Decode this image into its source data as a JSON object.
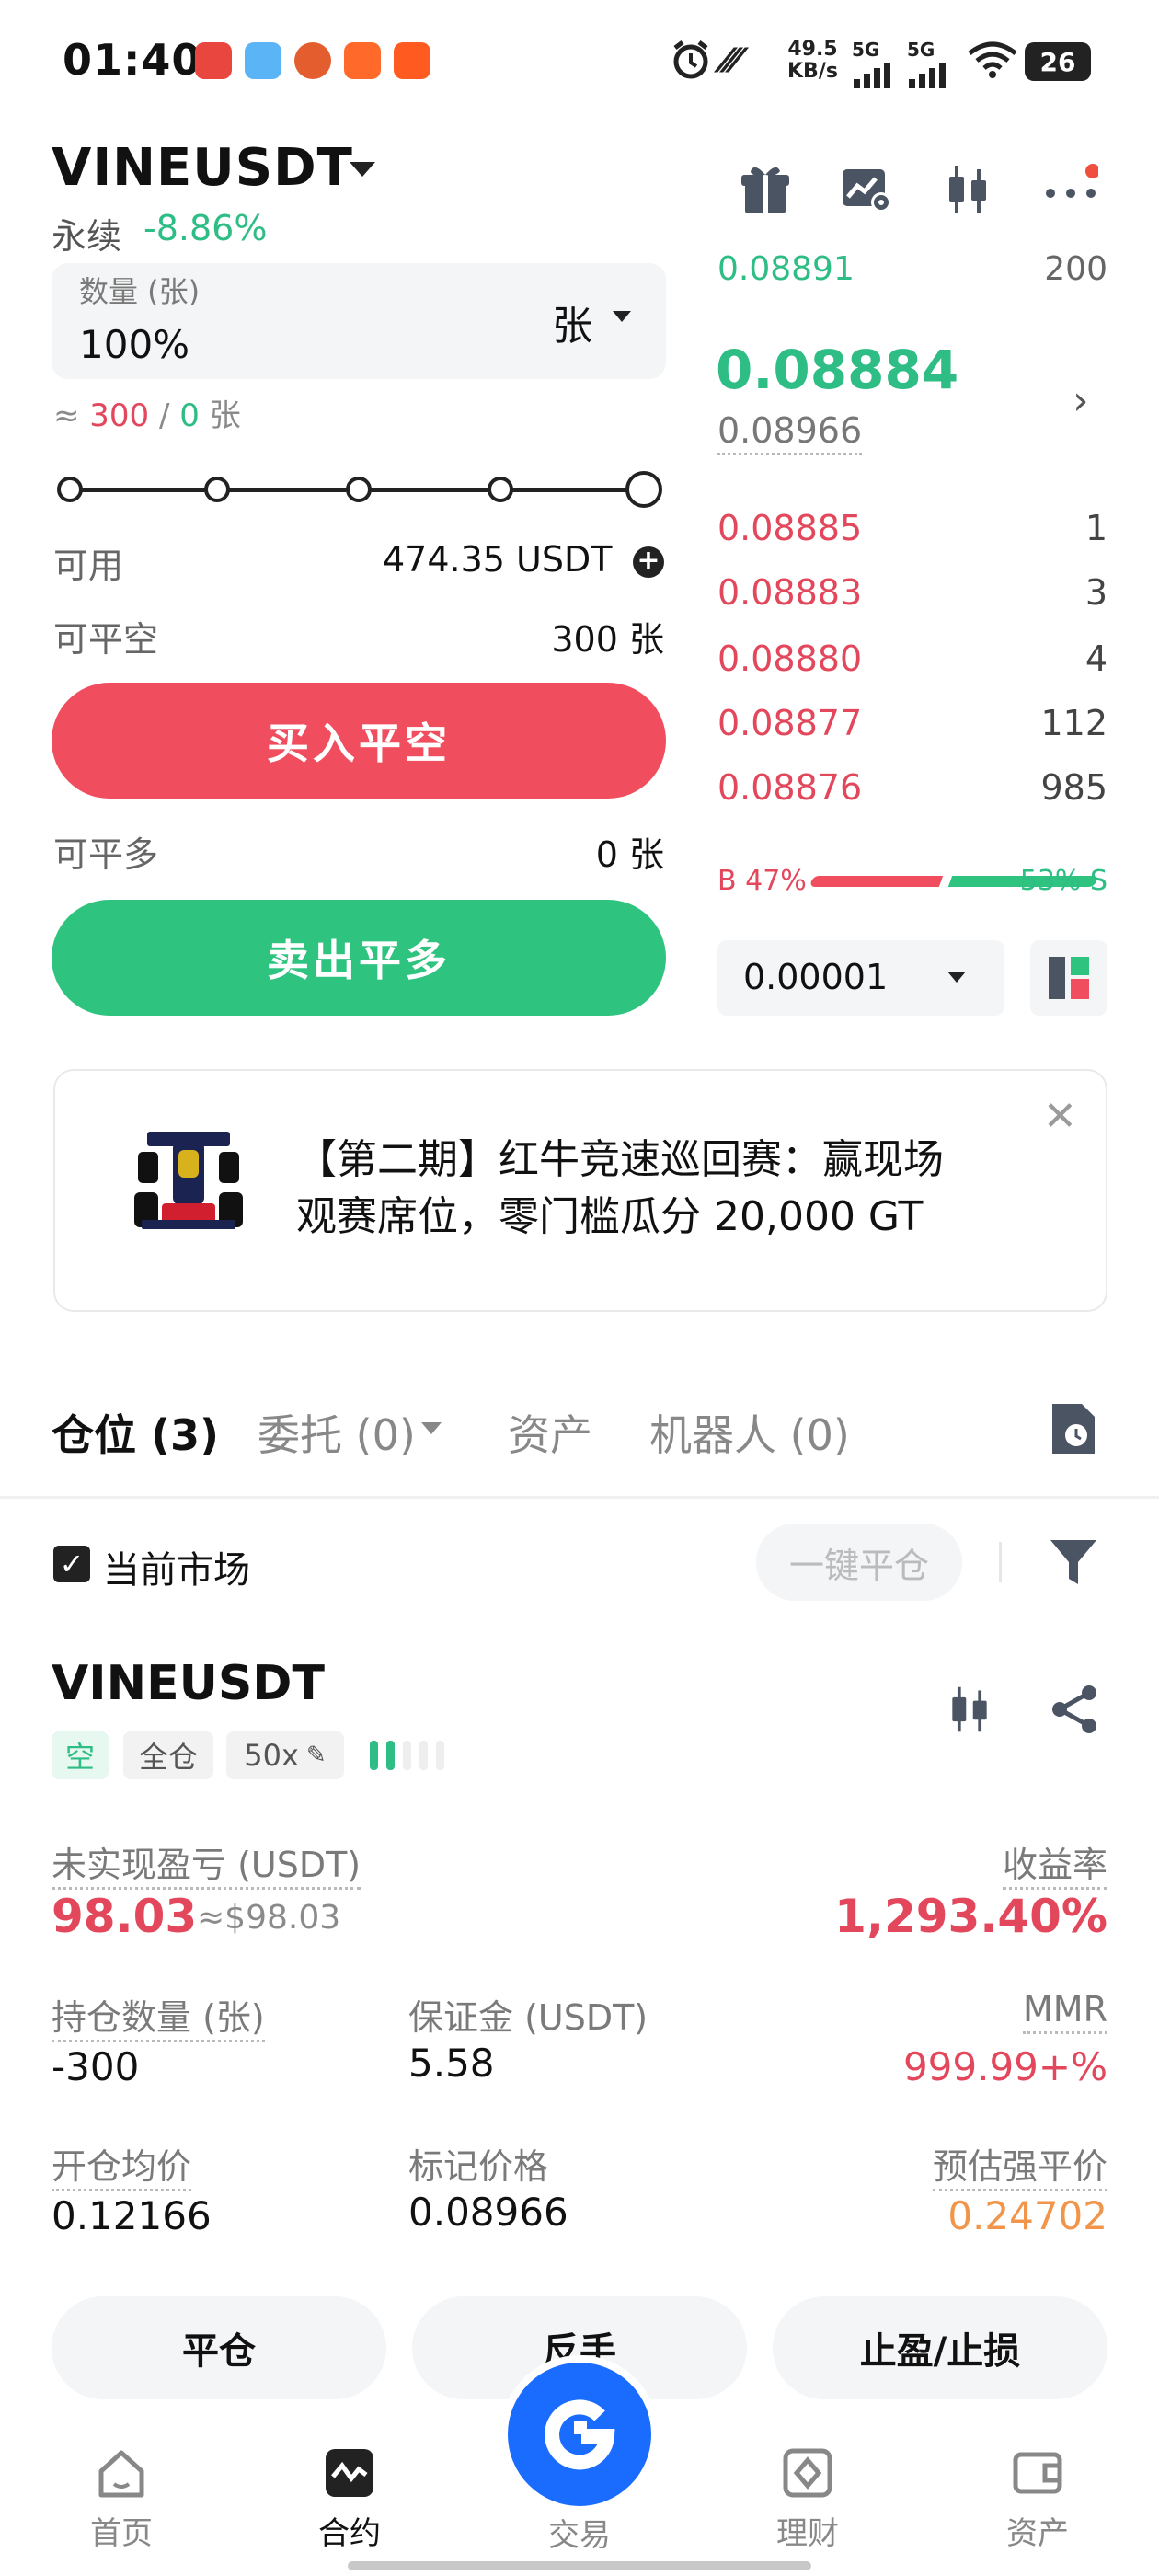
{
  "status_bar": {
    "time": "01:40",
    "net_speed": "49.5",
    "net_unit": "KB/s",
    "sig1": "5G",
    "sig2": "5G",
    "battery": "26"
  },
  "header": {
    "pair": "VINEUSDT",
    "type": "永续",
    "change": "-8.86%"
  },
  "form": {
    "qty_label": "数量 (张)",
    "qty_value": "100%",
    "unit": "张",
    "approx_prefix": "≈ ",
    "approx_red": "300",
    "approx_sep": " / ",
    "approx_green": "0",
    "approx_unit": " 张",
    "slider_fraction": 1.0,
    "available_label": "可用",
    "available_value": "474.35 USDT",
    "close_short_label": "可平空",
    "close_short_value": "300 张",
    "buy_close_short": "买入平空",
    "close_long_label": "可平多",
    "close_long_value": "0 张",
    "sell_close_long": "卖出平多"
  },
  "orderbook": {
    "top_price": "0.08891",
    "top_qty": "200",
    "last_price": "0.08884",
    "mark_price": "0.08966",
    "asks": [
      {
        "price": "0.08885",
        "qty": "1"
      },
      {
        "price": "0.08883",
        "qty": "3"
      },
      {
        "price": "0.08880",
        "qty": "4"
      },
      {
        "price": "0.08877",
        "qty": "112"
      },
      {
        "price": "0.08876",
        "qty": "985"
      }
    ],
    "buy_ratio": "B 47%",
    "sell_ratio": "53% S",
    "buy_pct": 47,
    "tick": "0.00001"
  },
  "banner": {
    "text_line1": "【第二期】红牛竞速巡回赛：赢现场",
    "text_line2": "观赛席位，零门槛瓜分 20,000 GT",
    "close": "✕"
  },
  "tabs": [
    "仓位 (3)",
    "委托 (0)",
    "资产",
    "机器人 (0)"
  ],
  "filter": {
    "current_market": "当前市场",
    "close_all": "一键平仓"
  },
  "position": {
    "pair": "VINEUSDT",
    "tags": {
      "side": "空",
      "mode": "全仓",
      "leverage": "50x"
    },
    "unrealized_label": "未实现盈亏 (USDT)",
    "unrealized_value": "98.03",
    "unrealized_usd": "≈$98.03",
    "roe_label": "收益率",
    "roe_value": "1,293.40%",
    "size_label": "持仓数量 (张)",
    "size_value": "-300",
    "margin_label": "保证金 (USDT)",
    "margin_value": "5.58",
    "mmr_label": "MMR",
    "mmr_value": "999.99+%",
    "entry_label": "开仓均价",
    "entry_value": "0.12166",
    "mark_label": "标记价格",
    "mark_value": "0.08966",
    "liq_label": "预估强平价",
    "liq_value": "0.24702",
    "buttons": {
      "close": "平仓",
      "reverse": "反手",
      "tpsl": "止盈/止损"
    }
  },
  "nav": {
    "home": "首页",
    "contract": "合约",
    "trade": "交易",
    "finance": "理财",
    "assets": "资产"
  },
  "colors": {
    "red": "#e2475b",
    "green": "#2ebd85",
    "brand_blue": "#1a6cff"
  }
}
